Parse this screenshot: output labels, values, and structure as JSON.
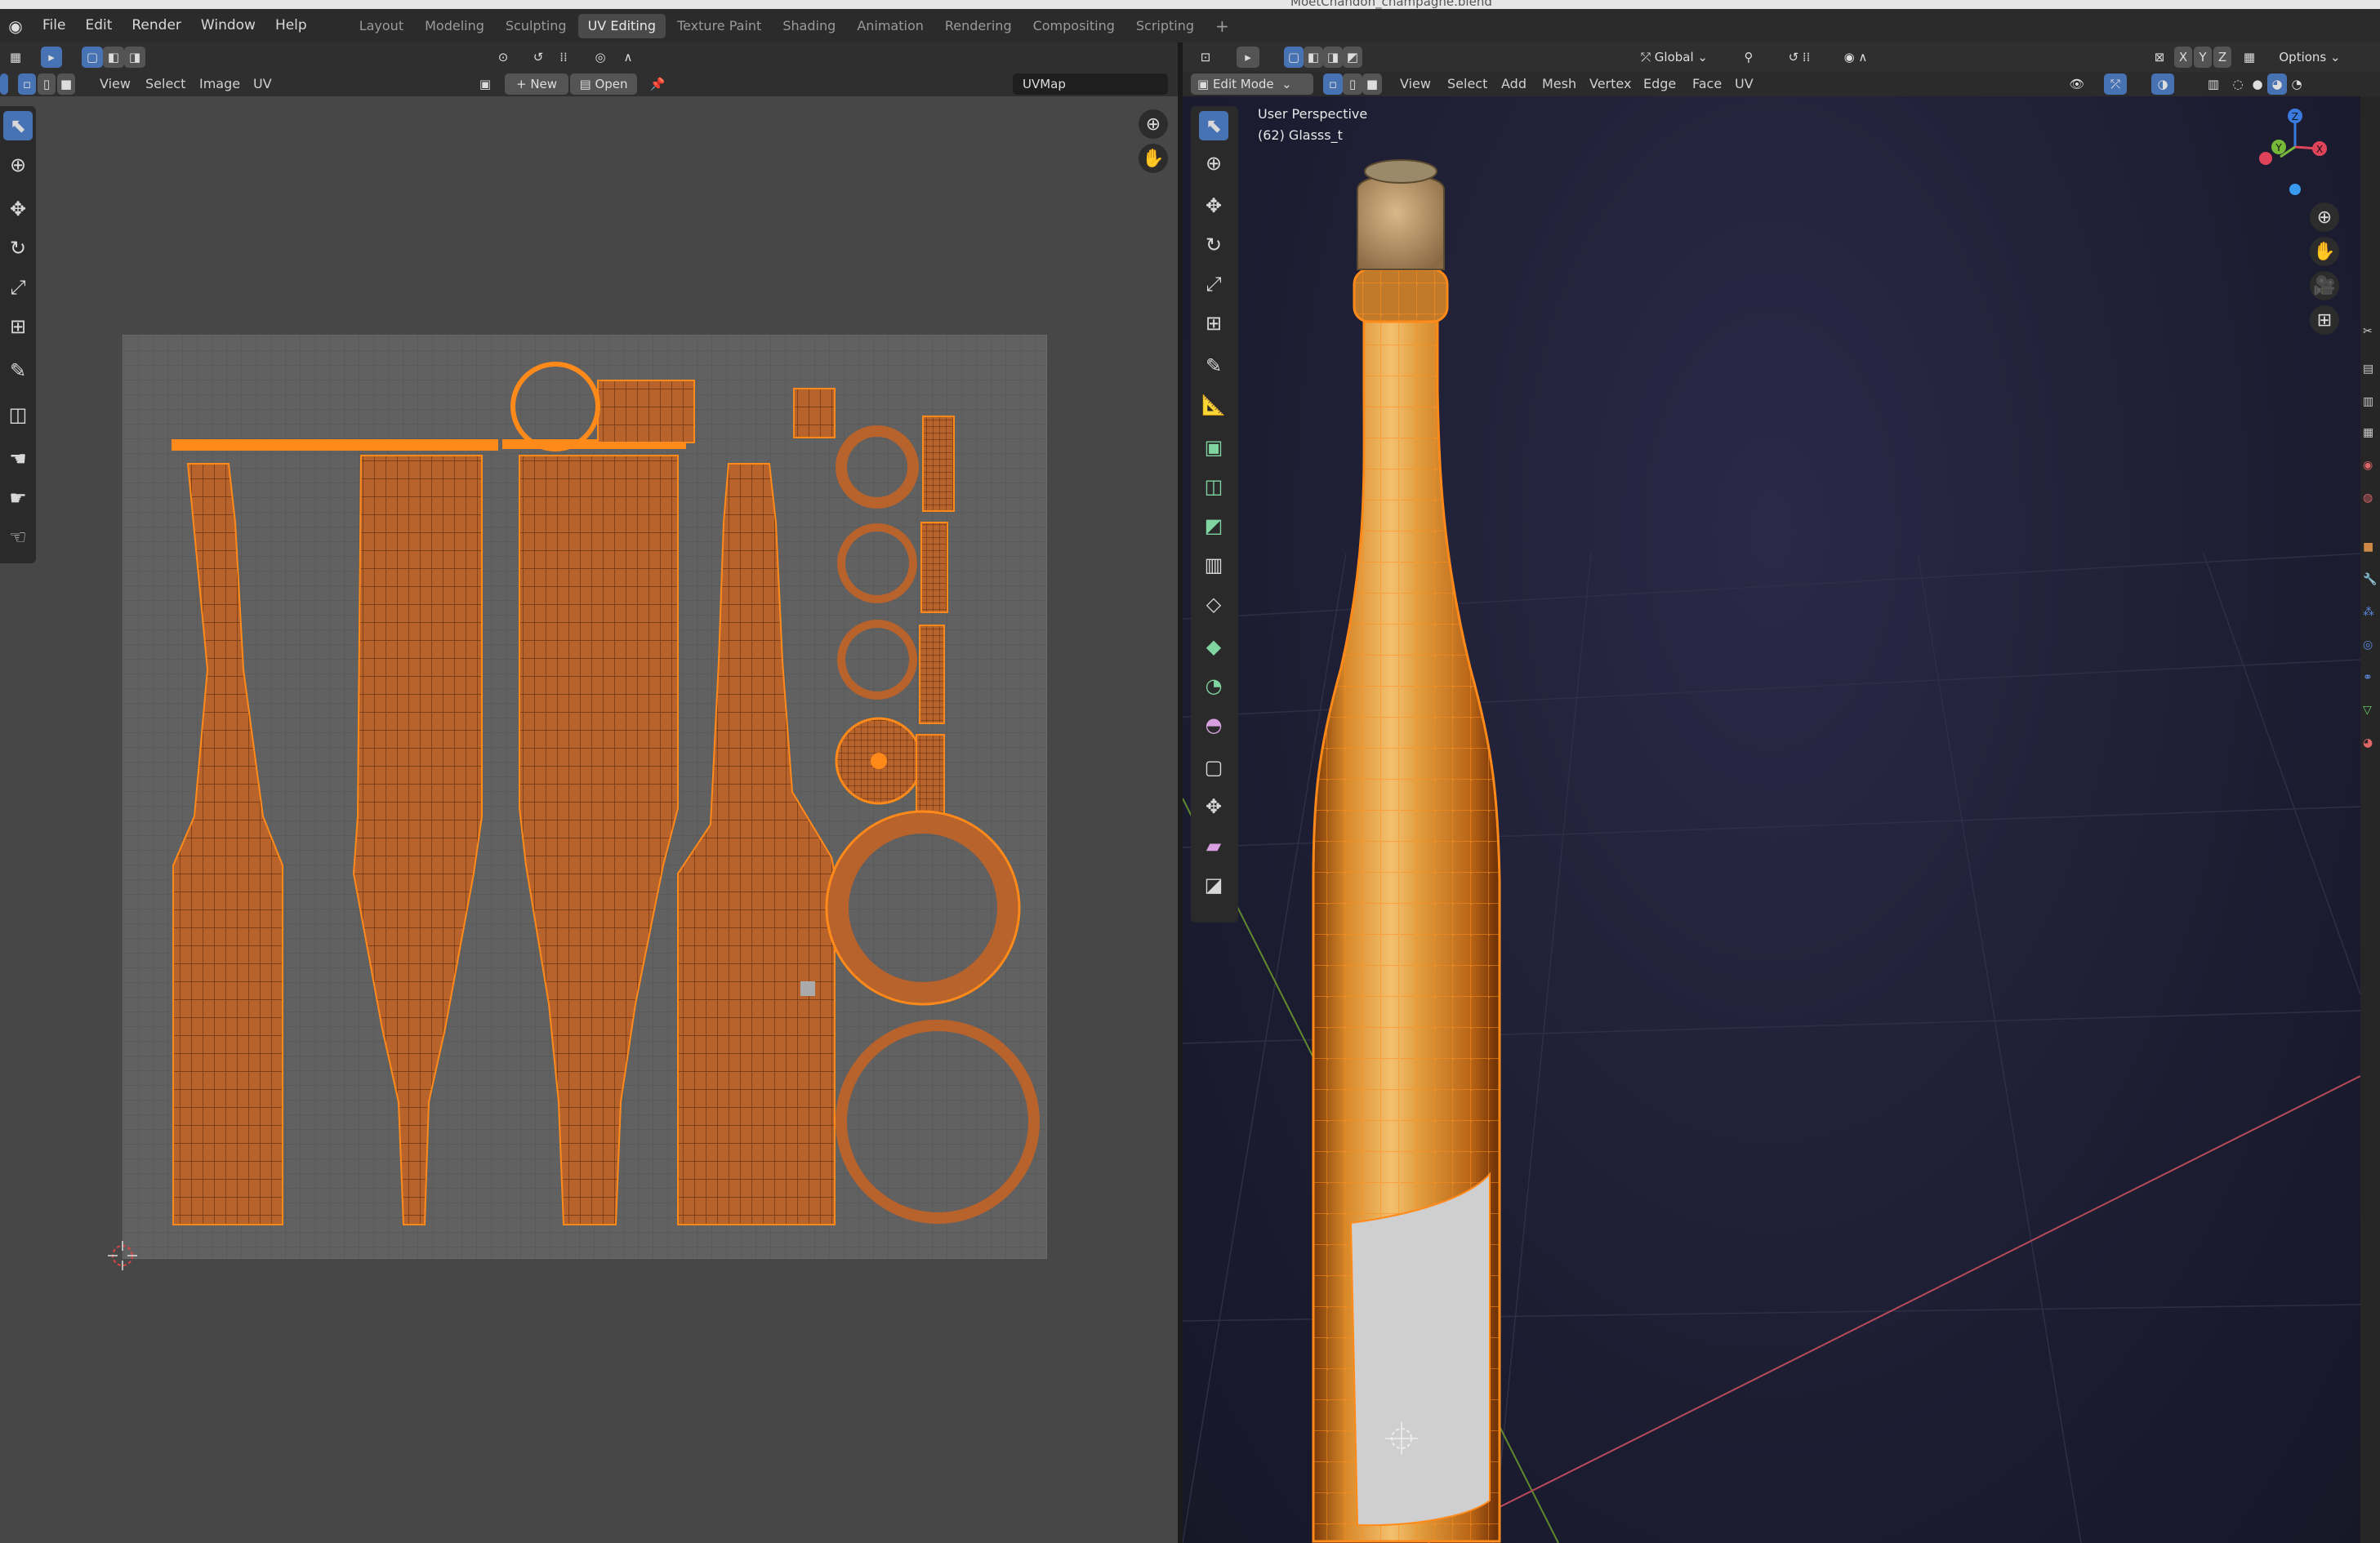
{
  "window_title": "MoetChandon_champagne.blend",
  "menu": [
    "File",
    "Edit",
    "Render",
    "Window",
    "Help"
  ],
  "workspace_tabs": [
    "Layout",
    "Modeling",
    "Sculpting",
    "UV Editing",
    "Texture Paint",
    "Shading",
    "Animation",
    "Rendering",
    "Compositing",
    "Scripting"
  ],
  "active_tab": "UV Editing",
  "uv_editor": {
    "menus": [
      "View",
      "Select",
      "Image",
      "UV"
    ],
    "new_label": "New",
    "open_label": "Open",
    "uv_map_name": "UVMap",
    "tools": [
      "select-icon",
      "cursor-icon",
      "move-icon",
      "rotate-icon",
      "scale-icon",
      "transform-icon",
      "annotate-icon",
      "rip-icon",
      "grab-icon",
      "relax-icon",
      "pinch-icon"
    ]
  },
  "viewport": {
    "mode": "Edit Mode",
    "menus": [
      "View",
      "Select",
      "Add",
      "Mesh",
      "Vertex",
      "Edge",
      "Face",
      "UV"
    ],
    "orientation": "Global",
    "options_label": "Options",
    "perspective_label": "User Perspective",
    "object_label": "(62) Glasss_t",
    "axes": [
      "X",
      "Y",
      "Z"
    ],
    "gizmo_labels": [
      "X",
      "Y",
      "Z"
    ],
    "tools": [
      "select-icon",
      "cursor-icon",
      "move-icon",
      "rotate-icon",
      "scale-icon",
      "transform-icon",
      "annotate-icon",
      "measure-icon",
      "extrude-icon",
      "inset-icon",
      "bevel-icon",
      "loop-cut-icon",
      "knife-icon",
      "poly-build-icon",
      "spin-icon",
      "smooth-icon",
      "edge-slide-icon",
      "shrink-icon",
      "shear-icon",
      "rip-region-icon"
    ]
  },
  "colors": {
    "accent": "#4772b3",
    "selection_orange": "#ff8a1a",
    "uv_fill": "#b8622c"
  }
}
